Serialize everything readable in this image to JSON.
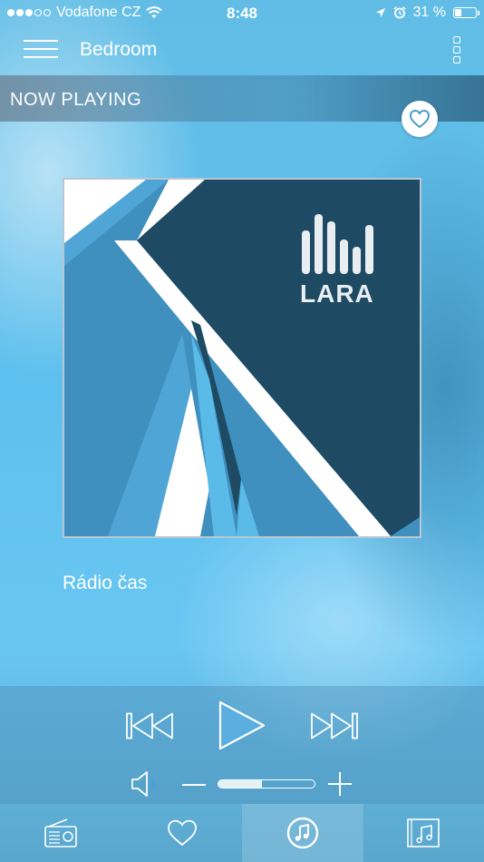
{
  "status_bar": {
    "carrier": "Vodafone CZ",
    "time": "8:48",
    "battery_percent": "31 %",
    "battery_level": 0.31,
    "signal_bars_filled": 3,
    "signal_bars_total": 5
  },
  "nav": {
    "title": "Bedroom",
    "menu_icon": "hamburger-icon",
    "more_icon": "more-vertical-icon"
  },
  "now_playing": {
    "label": "NOW PLAYING",
    "favorite_icon": "heart-icon"
  },
  "album": {
    "logo_text": "LARA",
    "colors": {
      "dark": "#1e4a63",
      "mid": "#3f90bf",
      "light": "#5bbbe8",
      "white": "#ffffff"
    }
  },
  "station": {
    "name": "Rádio čas"
  },
  "player": {
    "prev_icon": "skip-back-icon",
    "play_icon": "play-icon",
    "next_icon": "skip-forward-icon",
    "volume_icon": "speaker-icon",
    "volume_level": 0.45
  },
  "tabs": [
    {
      "id": "radio",
      "icon": "radio-icon",
      "active": false
    },
    {
      "id": "favorites",
      "icon": "heart-icon",
      "active": false
    },
    {
      "id": "now-playing",
      "icon": "music-note-circle-icon",
      "active": true
    },
    {
      "id": "library",
      "icon": "music-library-icon",
      "active": false
    }
  ],
  "colors": {
    "accent": "#5ec0ee",
    "play_fill": "#5aaee0",
    "heart": "#4a9cc8"
  }
}
